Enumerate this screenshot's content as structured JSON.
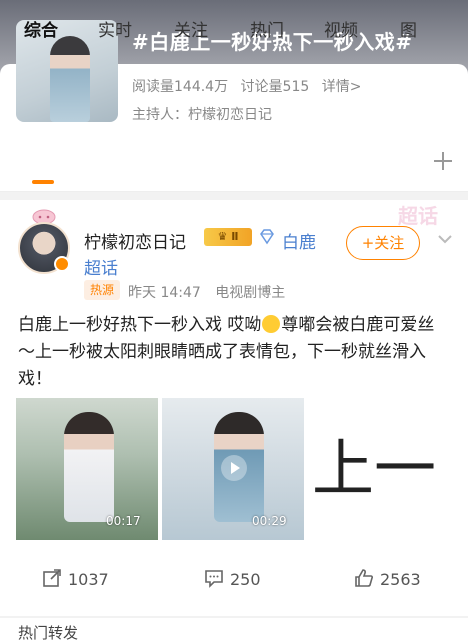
{
  "topic": {
    "title": "#白鹿上一秒好热下一秒入戏#",
    "read_count": "阅读量144.4万",
    "discuss_count": "讨论量515",
    "details_link": "详情>",
    "host": "主持人：柠檬初恋日记"
  },
  "tabs": [
    {
      "label": "综合",
      "active": true
    },
    {
      "label": "实时"
    },
    {
      "label": "关注"
    },
    {
      "label": "热门"
    },
    {
      "label": "视频"
    },
    {
      "label": "图"
    }
  ],
  "post": {
    "username": "柠檬初恋日记",
    "level_badge": "Ⅱ",
    "super_label_1": "白鹿",
    "super_label_2": "超话",
    "follow_label": "+关注",
    "hot_badge": "热源",
    "time": "昨天 14:47",
    "source": "电视剧博主",
    "text_part1": "白鹿上一秒好热下一秒入戏 哎呦",
    "text_part2": "尊嘟会被白鹿可爱丝～上一秒被太阳刺眼睛晒成了表情包，下一秒就丝滑入戏！",
    "media": [
      {
        "duration": "00:17"
      },
      {
        "duration": "00:29"
      },
      {
        "text": "上一"
      }
    ],
    "watermark": "超话"
  },
  "actions": {
    "repost": "1037",
    "comment": "250",
    "like": "2563"
  },
  "section_label": "热门转发",
  "colors": {
    "accent": "#ff8200",
    "link": "#4a7fcf"
  }
}
